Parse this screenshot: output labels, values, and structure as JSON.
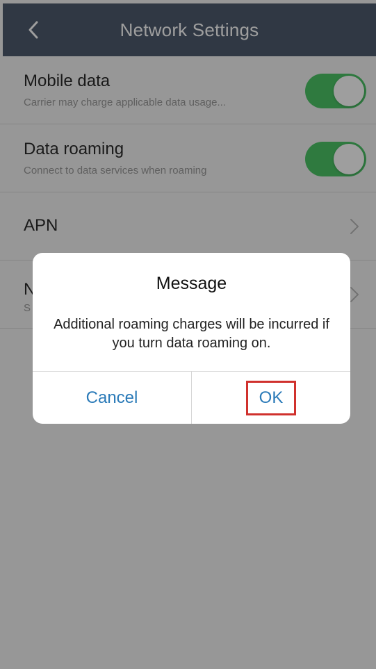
{
  "header": {
    "title": "Network Settings",
    "back_icon": "chevron-left-icon"
  },
  "settings": {
    "mobile_data": {
      "label": "Mobile data",
      "description": "Carrier may charge applicable data usage...",
      "enabled": true
    },
    "data_roaming": {
      "label": "Data roaming",
      "description": "Connect to data services when roaming",
      "enabled": true
    },
    "apn": {
      "label": "APN"
    },
    "network_partial": {
      "label": "N",
      "description": "S"
    }
  },
  "dialog": {
    "title": "Message",
    "message": "Additional roaming charges will be incurred if you turn data roaming on.",
    "cancel_label": "Cancel",
    "ok_label": "OK"
  },
  "colors": {
    "header_bg": "#4e5b6e",
    "toggle_on": "#4cc667",
    "button_text": "#2a7ab8",
    "highlight_border": "#d0312d"
  }
}
